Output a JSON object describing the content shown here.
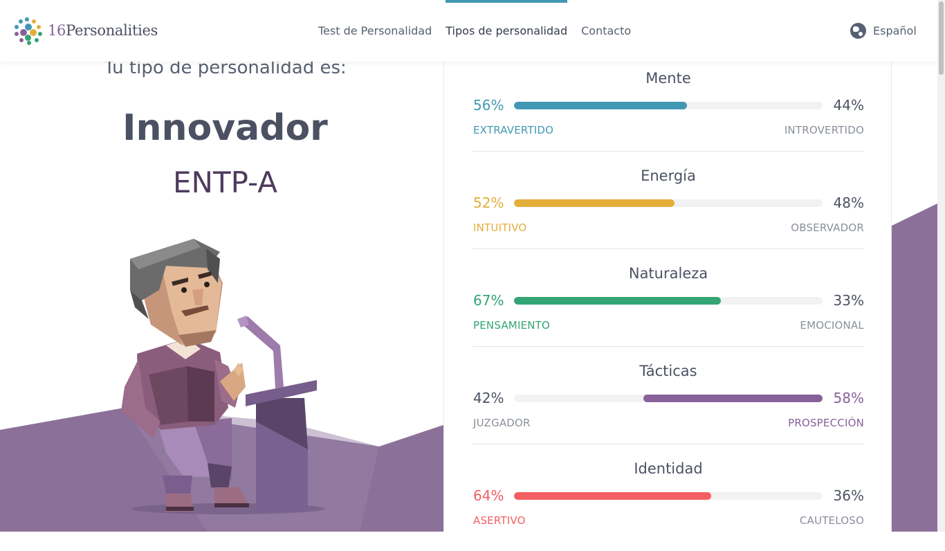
{
  "header": {
    "brand_number": "16",
    "brand_word": "Personalities",
    "nav": [
      {
        "label": "Test de Personalidad",
        "active": false
      },
      {
        "label": "Tipos de personalidad",
        "active": true
      },
      {
        "label": "Contacto",
        "active": false
      }
    ],
    "language": "Español",
    "language_icon": "globe-icon"
  },
  "result": {
    "subtitle": "Tu tipo de personalidad es:",
    "type_name": "Innovador",
    "type_code": "ENTP-A"
  },
  "traits": [
    {
      "title": "Mente",
      "left_pct": "56%",
      "right_pct": "44%",
      "left_label": "EXTRAVERTIDO",
      "right_label": "INTROVERTIDO",
      "dominant": "left",
      "value": 0.56,
      "color": "#4298b4"
    },
    {
      "title": "Energía",
      "left_pct": "52%",
      "right_pct": "48%",
      "left_label": "INTUITIVO",
      "right_label": "OBSERVADOR",
      "dominant": "left",
      "value": 0.52,
      "color": "#e4ae3a"
    },
    {
      "title": "Naturaleza",
      "left_pct": "67%",
      "right_pct": "33%",
      "left_label": "PENSAMIENTO",
      "right_label": "EMOCIONAL",
      "dominant": "left",
      "value": 0.67,
      "color": "#33a474"
    },
    {
      "title": "Tácticas",
      "left_pct": "42%",
      "right_pct": "58%",
      "left_label": "JUZGADOR",
      "right_label": "PROSPECCIÓN",
      "dominant": "right",
      "value": 0.58,
      "color": "#88619a"
    },
    {
      "title": "Identidad",
      "left_pct": "64%",
      "right_pct": "36%",
      "left_label": "ASERTIVO",
      "right_label": "CAUTELOSO",
      "dominant": "left",
      "value": 0.64,
      "color": "#f25e62"
    }
  ],
  "colors": {
    "accent": "#4298b4",
    "purple": "#88619a",
    "text": "#4b5162"
  }
}
